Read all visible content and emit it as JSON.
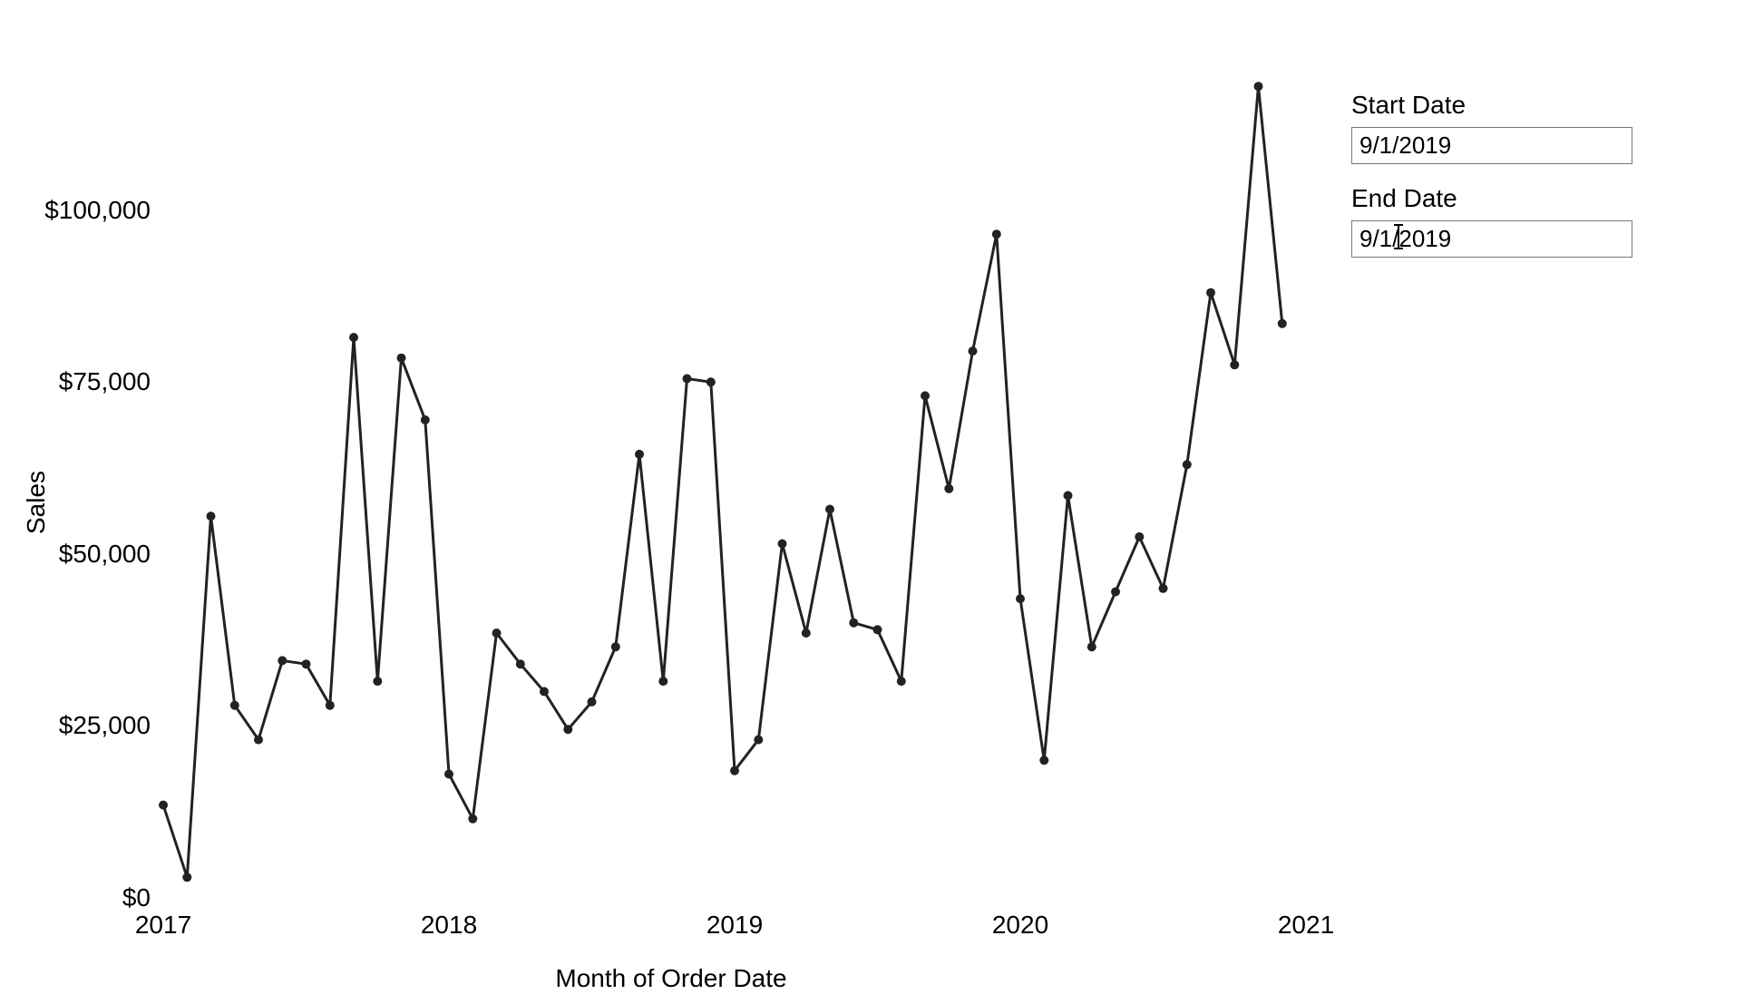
{
  "chart_data": {
    "type": "line",
    "xlabel": "Month of Order Date",
    "ylabel": "Sales",
    "ylim": [
      0,
      120000
    ],
    "y_ticks": [
      0,
      25000,
      50000,
      75000,
      100000
    ],
    "y_tick_labels": [
      "$0",
      "$25,000",
      "$50,000",
      "$75,000",
      "$100,000"
    ],
    "x_tick_years": [
      2017,
      2018,
      2019,
      2020,
      2021
    ],
    "x_tick_labels": [
      "2017",
      "2018",
      "2019",
      "2020",
      "2021"
    ],
    "series": [
      {
        "name": "Sales",
        "points": [
          {
            "year": 2017,
            "month": 1,
            "value": 13500
          },
          {
            "year": 2017,
            "month": 2,
            "value": 3000
          },
          {
            "year": 2017,
            "month": 3,
            "value": 55500
          },
          {
            "year": 2017,
            "month": 4,
            "value": 28000
          },
          {
            "year": 2017,
            "month": 5,
            "value": 23000
          },
          {
            "year": 2017,
            "month": 6,
            "value": 34500
          },
          {
            "year": 2017,
            "month": 7,
            "value": 34000
          },
          {
            "year": 2017,
            "month": 8,
            "value": 28000
          },
          {
            "year": 2017,
            "month": 9,
            "value": 81500
          },
          {
            "year": 2017,
            "month": 10,
            "value": 31500
          },
          {
            "year": 2017,
            "month": 11,
            "value": 78500
          },
          {
            "year": 2017,
            "month": 12,
            "value": 69500
          },
          {
            "year": 2018,
            "month": 1,
            "value": 18000
          },
          {
            "year": 2018,
            "month": 2,
            "value": 11500
          },
          {
            "year": 2018,
            "month": 3,
            "value": 38500
          },
          {
            "year": 2018,
            "month": 4,
            "value": 34000
          },
          {
            "year": 2018,
            "month": 5,
            "value": 30000
          },
          {
            "year": 2018,
            "month": 6,
            "value": 24500
          },
          {
            "year": 2018,
            "month": 7,
            "value": 28500
          },
          {
            "year": 2018,
            "month": 8,
            "value": 36500
          },
          {
            "year": 2018,
            "month": 9,
            "value": 64500
          },
          {
            "year": 2018,
            "month": 10,
            "value": 31500
          },
          {
            "year": 2018,
            "month": 11,
            "value": 75500
          },
          {
            "year": 2018,
            "month": 12,
            "value": 75000
          },
          {
            "year": 2019,
            "month": 1,
            "value": 18500
          },
          {
            "year": 2019,
            "month": 2,
            "value": 23000
          },
          {
            "year": 2019,
            "month": 3,
            "value": 51500
          },
          {
            "year": 2019,
            "month": 4,
            "value": 38500
          },
          {
            "year": 2019,
            "month": 5,
            "value": 56500
          },
          {
            "year": 2019,
            "month": 6,
            "value": 40000
          },
          {
            "year": 2019,
            "month": 7,
            "value": 39000
          },
          {
            "year": 2019,
            "month": 8,
            "value": 31500
          },
          {
            "year": 2019,
            "month": 9,
            "value": 73000
          },
          {
            "year": 2019,
            "month": 10,
            "value": 59500
          },
          {
            "year": 2019,
            "month": 11,
            "value": 79500
          },
          {
            "year": 2019,
            "month": 12,
            "value": 96500
          },
          {
            "year": 2020,
            "month": 1,
            "value": 43500
          },
          {
            "year": 2020,
            "month": 2,
            "value": 20000
          },
          {
            "year": 2020,
            "month": 3,
            "value": 58500
          },
          {
            "year": 2020,
            "month": 4,
            "value": 36500
          },
          {
            "year": 2020,
            "month": 5,
            "value": 44500
          },
          {
            "year": 2020,
            "month": 6,
            "value": 52500
          },
          {
            "year": 2020,
            "month": 7,
            "value": 45000
          },
          {
            "year": 2020,
            "month": 8,
            "value": 63000
          },
          {
            "year": 2020,
            "month": 9,
            "value": 88000
          },
          {
            "year": 2020,
            "month": 10,
            "value": 77500
          },
          {
            "year": 2020,
            "month": 11,
            "value": 118000
          },
          {
            "year": 2020,
            "month": 12,
            "value": 83500
          }
        ]
      }
    ]
  },
  "filters": {
    "start_label": "Start Date",
    "start_value": "9/1/2019",
    "end_label": "End Date",
    "end_value": "9/1/2019"
  }
}
